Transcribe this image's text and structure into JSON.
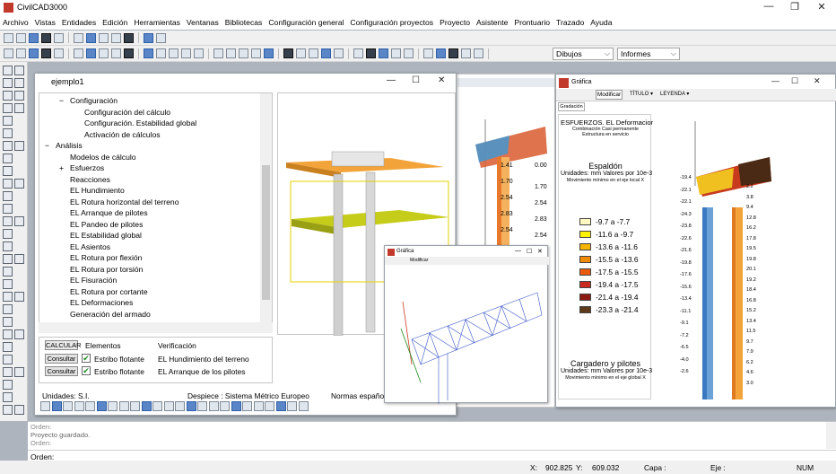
{
  "app": {
    "title": "CivilCAD3000",
    "win_min": "—",
    "win_max": "❐",
    "win_close": "✕"
  },
  "menu": [
    "Archivo",
    "Vistas",
    "Entidades",
    "Edición",
    "Herramientas",
    "Ventanas",
    "Bibliotecas",
    "Configuración general",
    "Configuración proyectos",
    "Proyecto",
    "Asistente",
    "Prontuario",
    "Trazado",
    "Ayuda"
  ],
  "toolbar": {
    "combo1": "Dibujos",
    "combo2": "Informes"
  },
  "project_window": {
    "title": "ejemplo1",
    "min": "—",
    "max": "☐",
    "close": "✕",
    "tree": [
      {
        "label": "Configuración",
        "indent": 1,
        "expander": "−"
      },
      {
        "label": "Configuración del cálculo",
        "indent": 2
      },
      {
        "label": "Configuración. Estabilidad global",
        "indent": 2
      },
      {
        "label": "Activación de cálculos",
        "indent": 2
      },
      {
        "label": "Análisis",
        "indent": 0,
        "expander": "−"
      },
      {
        "label": "Modelos de cálculo",
        "indent": 1
      },
      {
        "label": "Esfuerzos",
        "indent": 1,
        "expander": "+"
      },
      {
        "label": "Reacciones",
        "indent": 1
      },
      {
        "label": "EL Hundimiento",
        "indent": 1
      },
      {
        "label": "EL Rotura horizontal del terreno",
        "indent": 1
      },
      {
        "label": "EL Arranque de pilotes",
        "indent": 1
      },
      {
        "label": "EL Pandeo de pilotes",
        "indent": 1
      },
      {
        "label": "EL Estabilidad global",
        "indent": 1
      },
      {
        "label": "EL Asientos",
        "indent": 1
      },
      {
        "label": "EL Rotura por flexión",
        "indent": 1
      },
      {
        "label": "EL Rotura por torsión",
        "indent": 1
      },
      {
        "label": "EL Fisuración",
        "indent": 1
      },
      {
        "label": "EL Rotura por cortante",
        "indent": 1
      },
      {
        "label": "EL Deformaciones",
        "indent": 1
      },
      {
        "label": "Generación del armado",
        "indent": 1
      }
    ],
    "table": {
      "calc_button": "CALCULAR",
      "col_elementos": "Elementos",
      "col_verificacion": "Verificación",
      "rows": [
        {
          "button": "Consultar",
          "element": "Estribo flotante",
          "check": "EL Hundimiento del terreno"
        },
        {
          "button": "Consultar",
          "element": "Estribo flotante",
          "check": "EL Arranque de los pilotes"
        }
      ]
    },
    "status": {
      "units": "Unidades: S.I.",
      "despiece": "Despiece :  Sistema Métrico Europeo",
      "normas": "Normas español"
    }
  },
  "graph_window": {
    "title": "Gráfica",
    "toolbar": {
      "modify": "Modificar",
      "title_dd": "TÍTULO ▾",
      "legend_dd": "LEYENDA ▾"
    },
    "tab": "Gradación",
    "heading": "ESFUERZOS. EL Deformaciones",
    "sub1": "Combinación Casi permanente",
    "sub2": "Estructura en servicio",
    "section1": "Espaldón",
    "units": "Unidades: mm Valores por 10e-3",
    "note1": "Movimiento mínimo en el eje local X",
    "legend": [
      {
        "label": "-9.7 a  -7.7",
        "color": "#fff8c0"
      },
      {
        "label": "-11.6 a  -9.7",
        "color": "#fff200"
      },
      {
        "label": "-13.6 a -11.6",
        "color": "#f4b400"
      },
      {
        "label": "-15.5 a -13.6",
        "color": "#f08a00"
      },
      {
        "label": "-17.5 a -15.5",
        "color": "#ea5b0c"
      },
      {
        "label": "-19.4 a -17.5",
        "color": "#c8281e"
      },
      {
        "label": "-21.4 a -19.4",
        "color": "#8b1a10"
      },
      {
        "label": "-23.3 a -21.4",
        "color": "#5c3a1a"
      }
    ],
    "section2": "Cargadero y pilotes",
    "units2": "Unidades: mm Valores por 10e-3",
    "note2": "Movimiento mínimo en el eje global X",
    "left_values": [
      "-19.4",
      "-22.1",
      "-22.1",
      "-24.3",
      "-23.8",
      "-22.6",
      "-21.6",
      "-19.8",
      "-17.6",
      "-15.6",
      "-13.4",
      "-11.1",
      "-9.1",
      "-7.2",
      "-6.5",
      "-4.0",
      "-2.6"
    ],
    "right_values": [
      "2.2",
      "3.8",
      "9.4",
      "12.8",
      "16.2",
      "17.8",
      "19.5",
      "19.8",
      "20.1",
      "19.2",
      "18.4",
      "16.8",
      "15.2",
      "13.4",
      "11.5",
      "9.7",
      "7.9",
      "6.2",
      "4.6",
      "3.0"
    ]
  },
  "background_plot": {
    "values_a": [
      "1.41",
      "1.70",
      "2.54",
      "2.83",
      "2.54"
    ],
    "values_b": [
      "0.00",
      "1.70",
      "2.54",
      "2.83",
      "2.54"
    ]
  },
  "mini_window": {
    "title": "Gráfica",
    "modify": "Modificar"
  },
  "command": {
    "line1": "Orden:",
    "line2": "Proyecto guardado.",
    "line3": "Orden:",
    "prompt": "Orden:"
  },
  "statusbar": {
    "x_label": "X:",
    "x": "902.825",
    "y_label": "Y:",
    "y": "609.032",
    "capa": "Capa :",
    "eje": "Eje :",
    "num": "NUM"
  }
}
